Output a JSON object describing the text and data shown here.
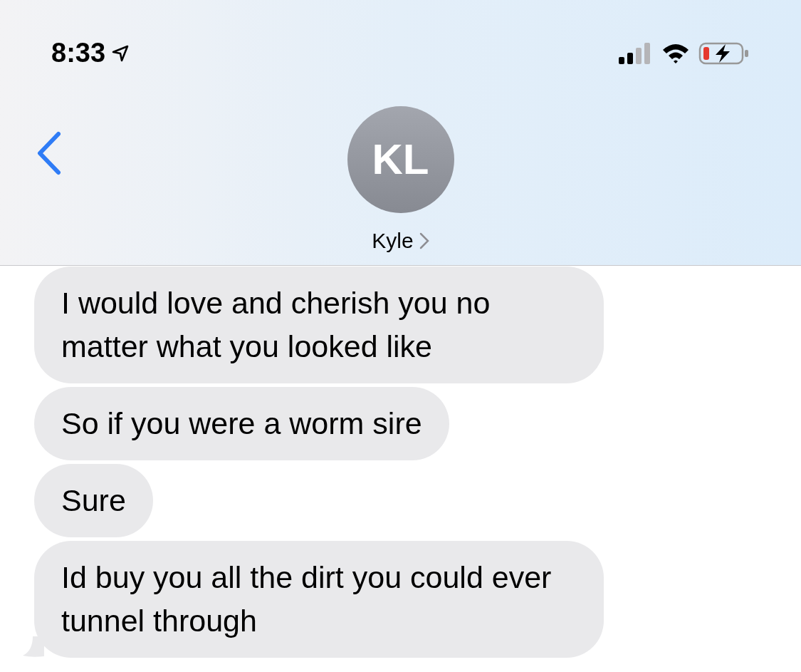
{
  "status_bar": {
    "time": "8:33"
  },
  "header": {
    "avatar_initials": "KL",
    "contact_name": "Kyle"
  },
  "messages": [
    {
      "text": "I would love and cherish you no matter what you looked like",
      "tail": false
    },
    {
      "text": "So if you were a worm sire",
      "tail": false
    },
    {
      "text": "Sure",
      "tail": false
    },
    {
      "text": "Id buy you all the dirt you could ever tunnel through",
      "tail": true
    }
  ]
}
